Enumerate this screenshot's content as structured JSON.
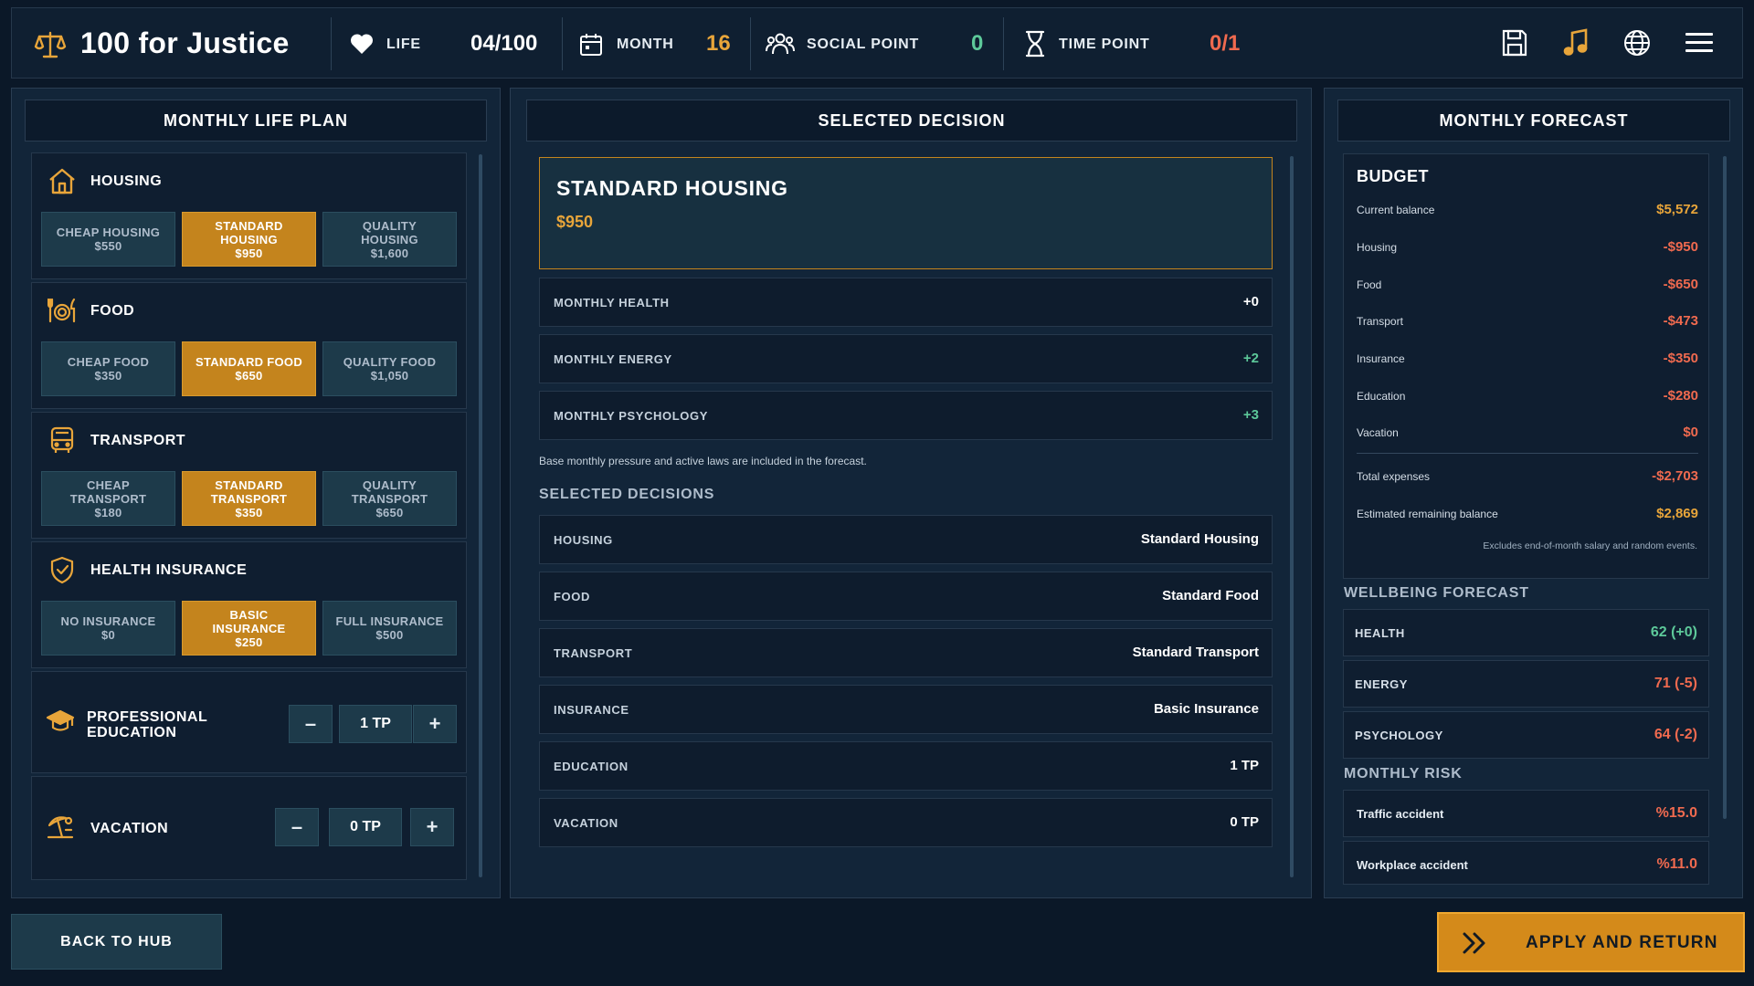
{
  "topbar": {
    "title": "100 for Justice",
    "life_label": "LIFE",
    "life_value": "04/100",
    "month_label": "MONTH",
    "month_value": "16",
    "social_label": "SOCIAL POINT",
    "social_value": "0",
    "time_label": "TIME POINT",
    "time_value": "0/1",
    "icons": [
      "justice-scale-icon",
      "heart-icon",
      "calendar-icon",
      "people-icon",
      "hourglass-icon",
      "save-icon",
      "music-icon",
      "globe-icon",
      "menu-icon"
    ]
  },
  "left": {
    "header": "MONTHLY LIFE PLAN",
    "categories": [
      {
        "title": "HOUSING",
        "icon": "house-icon",
        "options": [
          {
            "label": "CHEAP HOUSING\n$550",
            "selected": false
          },
          {
            "label": "STANDARD\nHOUSING\n$950",
            "selected": true
          },
          {
            "label": "QUALITY\nHOUSING\n$1,600",
            "selected": false
          }
        ]
      },
      {
        "title": "FOOD",
        "icon": "food-icon",
        "options": [
          {
            "label": "CHEAP FOOD\n$350",
            "selected": false
          },
          {
            "label": "STANDARD FOOD\n$650",
            "selected": true
          },
          {
            "label": "QUALITY FOOD\n$1,050",
            "selected": false
          }
        ]
      },
      {
        "title": "TRANSPORT",
        "icon": "bus-icon",
        "options": [
          {
            "label": "CHEAP\nTRANSPORT\n$180",
            "selected": false
          },
          {
            "label": "STANDARD\nTRANSPORT\n$350",
            "selected": true
          },
          {
            "label": "QUALITY\nTRANSPORT\n$650",
            "selected": false
          }
        ]
      },
      {
        "title": "HEALTH INSURANCE",
        "icon": "shield-check-icon",
        "options": [
          {
            "label": "NO INSURANCE\n$0",
            "selected": false
          },
          {
            "label": "BASIC\nINSURANCE\n$250",
            "selected": true
          },
          {
            "label": "FULL INSURANCE\n$500",
            "selected": false
          }
        ]
      }
    ],
    "education": {
      "title_line1": "PROFESSIONAL",
      "title_line2": "EDUCATION",
      "value": "1 TP",
      "minus": "–",
      "plus": "+"
    },
    "vacation": {
      "title": "VACATION",
      "value": "0 TP",
      "minus": "–",
      "plus": "+"
    }
  },
  "middle": {
    "header": "SELECTED DECISION",
    "selected_title": "STANDARD HOUSING",
    "selected_price": "$950",
    "effects": [
      {
        "label": "MONTHLY HEALTH",
        "value": "+0",
        "color": "#ffffff"
      },
      {
        "label": "MONTHLY ENERGY",
        "value": "+2",
        "color": "#5dc99a"
      },
      {
        "label": "MONTHLY PSYCHOLOGY",
        "value": "+3",
        "color": "#5dc99a"
      }
    ],
    "note": "Base monthly pressure and active laws are included in the forecast.",
    "decisions_header": "SELECTED DECISIONS",
    "decisions": [
      {
        "label": "HOUSING",
        "value": "Standard Housing"
      },
      {
        "label": "FOOD",
        "value": "Standard Food"
      },
      {
        "label": "TRANSPORT",
        "value": "Standard Transport"
      },
      {
        "label": "INSURANCE",
        "value": "Basic Insurance"
      },
      {
        "label": "EDUCATION",
        "value": "1 TP"
      },
      {
        "label": "VACATION",
        "value": "0 TP"
      }
    ]
  },
  "right": {
    "header": "MONTHLY FORECAST",
    "budget_title": "BUDGET",
    "budget_rows": [
      {
        "label": "Current balance",
        "value": "$5,572",
        "color": "#e8a53a"
      },
      {
        "label": "Housing",
        "value": "-$950",
        "color": "#f06a4f"
      },
      {
        "label": "Food",
        "value": "-$650",
        "color": "#f06a4f"
      },
      {
        "label": "Transport",
        "value": "-$473",
        "color": "#f06a4f"
      },
      {
        "label": "Insurance",
        "value": "-$350",
        "color": "#f06a4f"
      },
      {
        "label": "Education",
        "value": "-$280",
        "color": "#f06a4f"
      },
      {
        "label": "Vacation",
        "value": "$0",
        "color": "#f06a4f"
      }
    ],
    "total_label": "Total expenses",
    "total_value": "-$2,703",
    "remaining_label": "Estimated remaining balance",
    "remaining_value": "$2,869",
    "budget_note": "Excludes end-of-month salary and random events.",
    "wellbeing_header": "WELLBEING FORECAST",
    "wellbeing": [
      {
        "label": "HEALTH",
        "value": "62  (+0)",
        "color": "#5dc99a"
      },
      {
        "label": "ENERGY",
        "value": "71  (-5)",
        "color": "#f06a4f"
      },
      {
        "label": "PSYCHOLOGY",
        "value": "64  (-2)",
        "color": "#f06a4f"
      }
    ],
    "risk_header": "MONTHLY RISK",
    "risks": [
      {
        "label": "Traffic accident",
        "value": "%15.0",
        "color": "#f06a4f"
      },
      {
        "label": "Workplace accident",
        "value": "%11.0",
        "color": "#f06a4f"
      }
    ]
  },
  "bottom": {
    "back_label": "BACK TO HUB",
    "apply_label": "APPLY AND RETURN"
  },
  "colors": {
    "accent": "#c4841d",
    "positive": "#5dc99a",
    "negative": "#f06a4f",
    "money": "#e8a53a"
  }
}
